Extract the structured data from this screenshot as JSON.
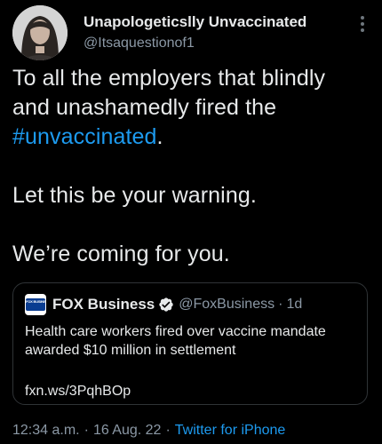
{
  "tweet": {
    "author": {
      "display_name": "Unapologeticslly Unvaccinated",
      "handle": "@Itsaquestionof1",
      "avatar_icon": "user-avatar"
    },
    "text": {
      "line1": "To all the employers that blindly and unashamedly fired the",
      "hashtag": "#unvaccinated",
      "hashtag_suffix": ".",
      "line2": "Let this be your warning.",
      "line3": "We’re coming for you."
    },
    "quoted": {
      "logo_text": "FOX BUSINESS",
      "display_name": "FOX Business",
      "verified_icon": "verified-badge-icon",
      "handle": "@FoxBusiness",
      "dot": "·",
      "time": "1d",
      "text": "Health care workers fired over vaccine mandate awarded $10 million in settlement",
      "link": "fxn.ws/3PqhBOp"
    },
    "meta": {
      "time": "12:34 a.m.",
      "sep1": "·",
      "date": "16 Aug. 22",
      "sep2": "·",
      "source": "Twitter for iPhone"
    },
    "more_icon": "more-options-icon"
  },
  "colors": {
    "background": "#000000",
    "text": "#e7e9ea",
    "secondary": "#8b98a5",
    "link": "#1d9bf0",
    "border": "#2f3336"
  }
}
